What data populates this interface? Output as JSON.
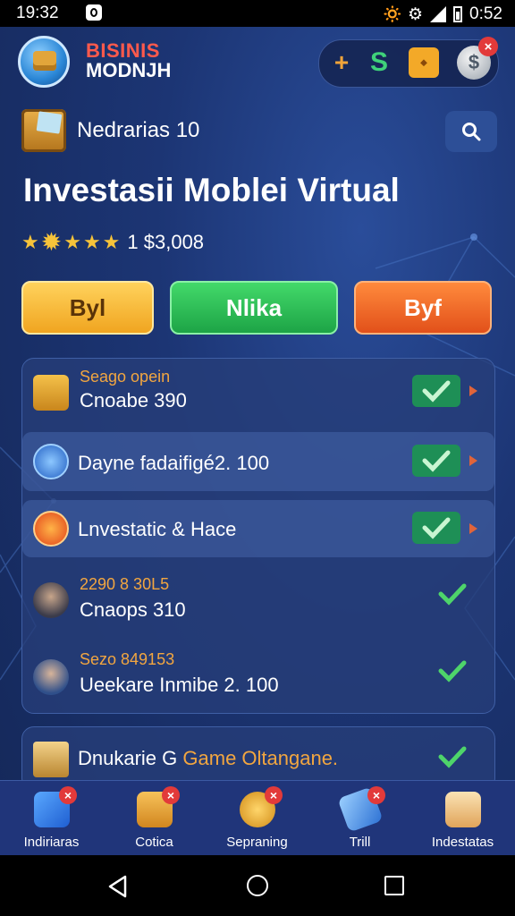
{
  "status_bar": {
    "time": "19:32",
    "right_time": "0:52",
    "right_icons": "🔅 ⚙"
  },
  "header": {
    "brand_line1": "BISINIS",
    "brand_line2": "MODNJH",
    "toolbar": {
      "plus": "+",
      "swap": "S",
      "gift": "⬩",
      "coin": "$",
      "badge": "×"
    }
  },
  "section": {
    "subtitle": "Nedrarias 10",
    "headline": "Investasii Moblei Virtual",
    "rating_text": "1 $3,008"
  },
  "actions": [
    {
      "label": "Byl"
    },
    {
      "label": "Nlika"
    },
    {
      "label": "Byf"
    }
  ],
  "list": {
    "row1": {
      "title": "Seago opein",
      "subtitle": "Cnoabe 390"
    },
    "row2": {
      "text": "Dayne fadaifigé2. 100"
    },
    "row3": {
      "text": "Lnvestatic & Hace"
    },
    "row4": {
      "title": "2290 8 30L5",
      "subtitle": "Cnaops 310"
    },
    "row5": {
      "title": "Sezo 849153",
      "subtitle": "Ueekare Inmibe 2. 100"
    }
  },
  "card2": {
    "text_white": "Dnukarie G ",
    "text_orange": "Game Oltangane."
  },
  "bottom_nav": [
    {
      "label": "Indiriaras",
      "badge": "×"
    },
    {
      "label": "Cotica",
      "badge": "×"
    },
    {
      "label": "Sepraning",
      "badge": "×"
    },
    {
      "label": "Trill",
      "badge": "×"
    },
    {
      "label": "Indestatas"
    }
  ],
  "colors": {
    "accent_green": "#1e8f56",
    "accent_orange": "#f2a640",
    "background": "#1c3574"
  }
}
